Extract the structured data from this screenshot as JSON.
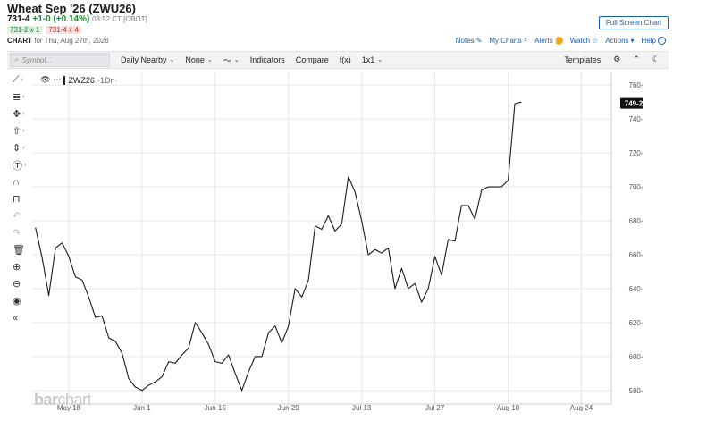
{
  "header": {
    "title": "Wheat Sep '26 (ZWU26)",
    "last": "731-4",
    "change": "+1-0 (+0.14%)",
    "time": "08:52 CT [CBOT]",
    "bid": "731-2 x 1",
    "ask": "731-4 x 4",
    "chart_for_label": "CHART",
    "chart_for_date": "for Thu, Aug 27th, 2026",
    "full_screen": "Full Screen Chart"
  },
  "top_links": {
    "notes": "Notes",
    "my_charts": "My Charts",
    "alerts": "Alerts",
    "alerts_badge": "!",
    "watch": "Watch",
    "actions": "Actions",
    "help": "Help"
  },
  "toolbar": {
    "search_placeholder": "Symbol...",
    "daily_nearby": "Daily Nearby",
    "none": "None",
    "indicators": "Indicators",
    "compare": "Compare",
    "fx": "f(x)",
    "layout": "1x1",
    "templates": "Templates"
  },
  "legend": {
    "symbol": "ZWZ26",
    "interval": "·1Dn·"
  },
  "watermark": {
    "bold": "bar",
    "rest": "chart"
  },
  "colors": {
    "line": "#1a1a1a",
    "grid": "#e6e6e6",
    "price_tag": "#111111",
    "accent": "#1f5fa8"
  },
  "chart_data": {
    "type": "line",
    "series": [
      {
        "values": [
          676,
          658,
          636,
          664,
          667,
          659,
          647,
          645,
          635,
          623,
          624,
          611,
          609,
          602,
          587,
          582,
          580,
          583,
          585,
          588,
          597,
          596,
          601,
          605,
          620,
          614,
          607,
          597,
          596,
          601,
          590,
          580,
          591,
          600,
          600,
          614,
          618,
          608,
          618,
          640,
          635,
          645,
          677,
          675,
          683,
          674,
          678,
          706,
          697,
          680,
          660,
          663,
          661,
          664,
          640,
          652,
          640,
          643,
          632,
          640,
          659,
          648,
          669,
          668,
          689,
          689,
          681,
          698,
          700,
          700,
          700,
          704,
          749,
          750
        ]
      }
    ],
    "ylim": [
      572,
      768
    ],
    "yticks": [
      "760-0",
      "740-0",
      "720-0",
      "700-0",
      "680-0",
      "660-0",
      "640-0",
      "620-0",
      "600-0",
      "580-0"
    ],
    "ytick_values": [
      760,
      740,
      720,
      700,
      680,
      660,
      640,
      620,
      600,
      580
    ],
    "xticks": [
      "May 18",
      "Jun 1",
      "Jun 15",
      "Jun 29",
      "Jul 13",
      "Jul 27",
      "Aug 10",
      "Aug 24"
    ],
    "xtick_index": [
      5,
      16,
      27,
      38,
      49,
      60,
      71,
      82
    ],
    "x_count": 87,
    "last_price_label": "749-2",
    "last_price": 749.25,
    "grid": true
  }
}
